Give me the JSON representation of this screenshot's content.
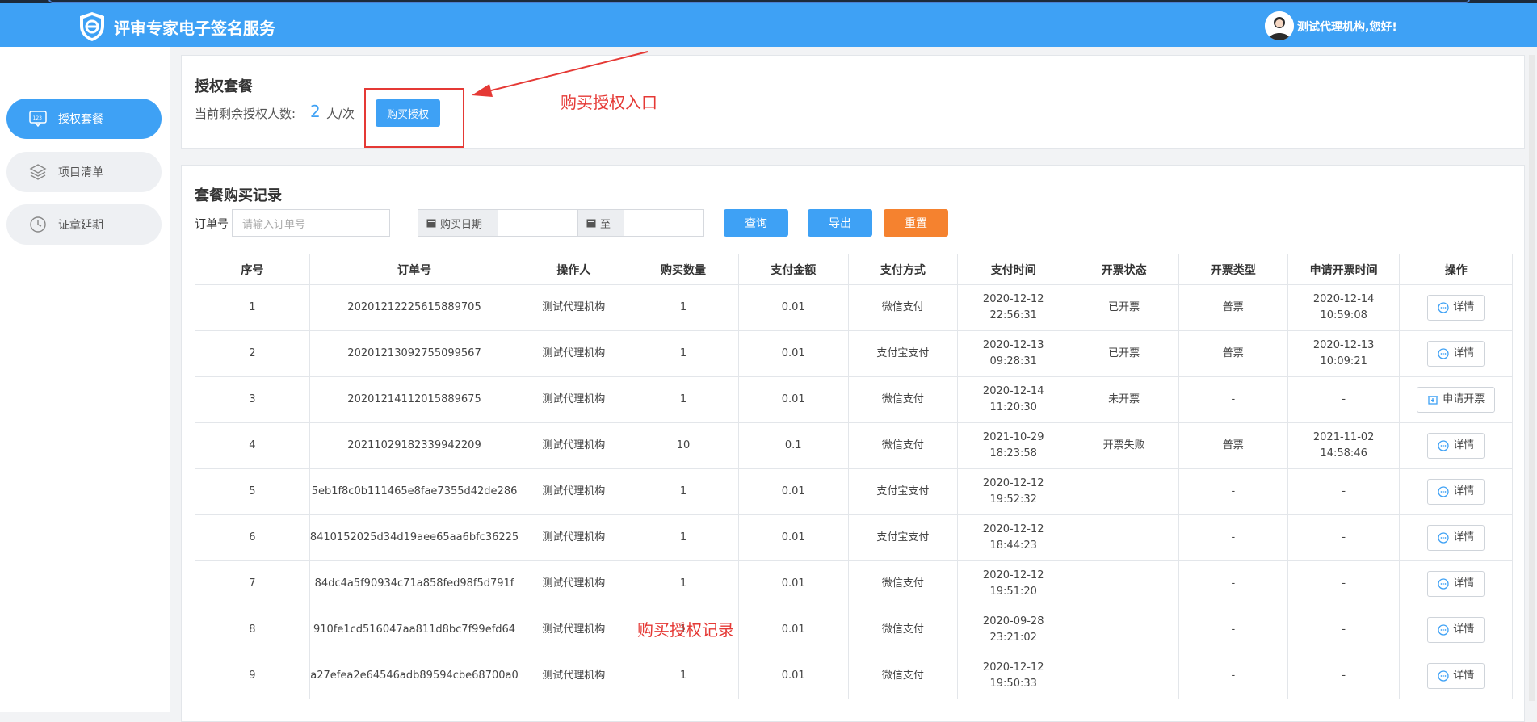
{
  "header": {
    "title": "评审专家电子签名服务",
    "greeting": "测试代理机构,您好!"
  },
  "sidebar": {
    "items": [
      {
        "label": "授权套餐",
        "icon": "package-icon",
        "active": true
      },
      {
        "label": "项目清单",
        "icon": "layers-icon",
        "active": false
      },
      {
        "label": "证章延期",
        "icon": "clock-icon",
        "active": false
      }
    ]
  },
  "auth_package": {
    "title": "授权套餐",
    "remain_label": "当前剩余授权人数:",
    "remain_count": "2",
    "remain_unit": "人/次",
    "buy_button": "购买授权"
  },
  "annotations": {
    "buy_entry": "购买授权入口",
    "buy_records": "购买授权记录"
  },
  "records": {
    "title": "套餐购买记录",
    "filter": {
      "order_label": "订单号",
      "order_placeholder": "请输入订单号",
      "date_label": "购买日期",
      "to_label": "至",
      "query_button": "查询",
      "export_button": "导出",
      "reset_button": "重置"
    },
    "columns": [
      "序号",
      "订单号",
      "操作人",
      "购买数量",
      "支付金额",
      "支付方式",
      "支付时间",
      "开票状态",
      "开票类型",
      "申请开票时间",
      "操作"
    ],
    "rows": [
      {
        "no": "1",
        "order": "20201212225615889705",
        "operator": "测试代理机构",
        "qty": "1",
        "amount": "0.01",
        "pay_method": "微信支付",
        "pay_date": "2020-12-12",
        "pay_time": "22:56:31",
        "invoice_status": "已开票",
        "invoice_type": "普票",
        "apply_date": "2020-12-14",
        "apply_time": "10:59:08",
        "action": "详情"
      },
      {
        "no": "2",
        "order": "20201213092755099567",
        "operator": "测试代理机构",
        "qty": "1",
        "amount": "0.01",
        "pay_method": "支付宝支付",
        "pay_date": "2020-12-13",
        "pay_time": "09:28:31",
        "invoice_status": "已开票",
        "invoice_type": "普票",
        "apply_date": "2020-12-13",
        "apply_time": "10:09:21",
        "action": "详情"
      },
      {
        "no": "3",
        "order": "20201214112015889675",
        "operator": "测试代理机构",
        "qty": "1",
        "amount": "0.01",
        "pay_method": "微信支付",
        "pay_date": "2020-12-14",
        "pay_time": "11:20:30",
        "invoice_status": "未开票",
        "invoice_type": "-",
        "apply_date": "-",
        "apply_time": "",
        "action": "申请开票"
      },
      {
        "no": "4",
        "order": "20211029182339942209",
        "operator": "测试代理机构",
        "qty": "10",
        "amount": "0.1",
        "pay_method": "微信支付",
        "pay_date": "2021-10-29",
        "pay_time": "18:23:58",
        "invoice_status": "开票失败",
        "invoice_type": "普票",
        "apply_date": "2021-11-02",
        "apply_time": "14:58:46",
        "action": "详情"
      },
      {
        "no": "5",
        "order": "5eb1f8c0b111465e8fae7355d42de286",
        "operator": "测试代理机构",
        "qty": "1",
        "amount": "0.01",
        "pay_method": "支付宝支付",
        "pay_date": "2020-12-12",
        "pay_time": "19:52:32",
        "invoice_status": "",
        "invoice_type": "-",
        "apply_date": "-",
        "apply_time": "",
        "action": "详情"
      },
      {
        "no": "6",
        "order": "8410152025d34d19aee65aa6bfc36225",
        "operator": "测试代理机构",
        "qty": "1",
        "amount": "0.01",
        "pay_method": "支付宝支付",
        "pay_date": "2020-12-12",
        "pay_time": "18:44:23",
        "invoice_status": "",
        "invoice_type": "-",
        "apply_date": "-",
        "apply_time": "",
        "action": "详情"
      },
      {
        "no": "7",
        "order": "84dc4a5f90934c71a858fed98f5d791f",
        "operator": "测试代理机构",
        "qty": "1",
        "amount": "0.01",
        "pay_method": "微信支付",
        "pay_date": "2020-12-12",
        "pay_time": "19:51:20",
        "invoice_status": "",
        "invoice_type": "-",
        "apply_date": "-",
        "apply_time": "",
        "action": "详情"
      },
      {
        "no": "8",
        "order": "910fe1cd516047aa811d8bc7f99efd64",
        "operator": "测试代理机构",
        "qty": "1",
        "amount": "0.01",
        "pay_method": "微信支付",
        "pay_date": "2020-09-28",
        "pay_time": "23:21:02",
        "invoice_status": "",
        "invoice_type": "-",
        "apply_date": "-",
        "apply_time": "",
        "action": "详情"
      },
      {
        "no": "9",
        "order": "a27efea2e64546adb89594cbe68700a0",
        "operator": "测试代理机构",
        "qty": "1",
        "amount": "0.01",
        "pay_method": "微信支付",
        "pay_date": "2020-12-12",
        "pay_time": "19:50:33",
        "invoice_status": "",
        "invoice_type": "-",
        "apply_date": "-",
        "apply_time": "",
        "action": "详情"
      }
    ]
  },
  "colors": {
    "primary": "#3ea1f5",
    "reset": "#f5822f",
    "annotation": "#e53935"
  }
}
